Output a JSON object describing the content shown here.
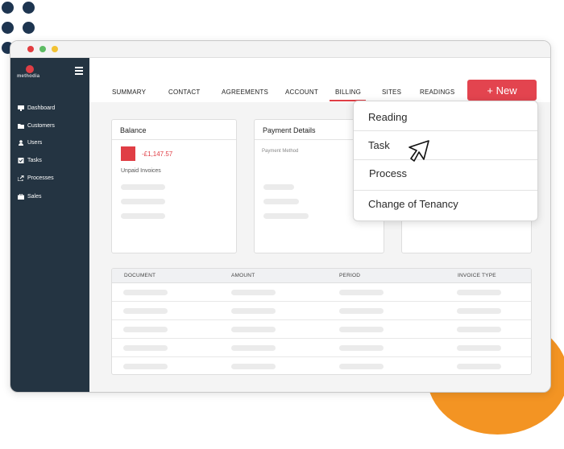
{
  "sidebar": {
    "logo_text": "methodia",
    "items": [
      {
        "label": "Dashboard",
        "icon": "monitor-icon"
      },
      {
        "label": "Customers",
        "icon": "folder-icon"
      },
      {
        "label": "Users",
        "icon": "user-icon"
      },
      {
        "label": "Tasks",
        "icon": "checkbox-icon"
      },
      {
        "label": "Processes",
        "icon": "export-icon"
      },
      {
        "label": "Sales",
        "icon": "briefcase-icon"
      }
    ]
  },
  "tabs": [
    {
      "label": "SUMMARY"
    },
    {
      "label": "CONTACT"
    },
    {
      "label": "AGREEMENTS"
    },
    {
      "label": "ACCOUNT"
    },
    {
      "label": "BILLING",
      "active": true
    },
    {
      "label": "SITES"
    },
    {
      "label": "READINGS"
    }
  ],
  "new_button": {
    "label": "+ New"
  },
  "balance_card": {
    "title": "Balance",
    "amount": "-£1,147.57",
    "label": "Unpaid Invoices"
  },
  "payment_card": {
    "title": "Payment Details",
    "method_label": "Payment Method"
  },
  "table": {
    "columns": [
      "DOCUMENT",
      "AMOUNT",
      "PERIOD",
      "INVOICE TYPE"
    ]
  },
  "dropdown": {
    "items": [
      {
        "label": "Reading"
      },
      {
        "label": "Task"
      },
      {
        "label": "Process"
      },
      {
        "label": "Change of Tenancy"
      }
    ]
  },
  "colors": {
    "accent": "#e3444f",
    "sidebar": "#243442",
    "orange": "#f39423",
    "navy_dots": "#1e3550"
  }
}
